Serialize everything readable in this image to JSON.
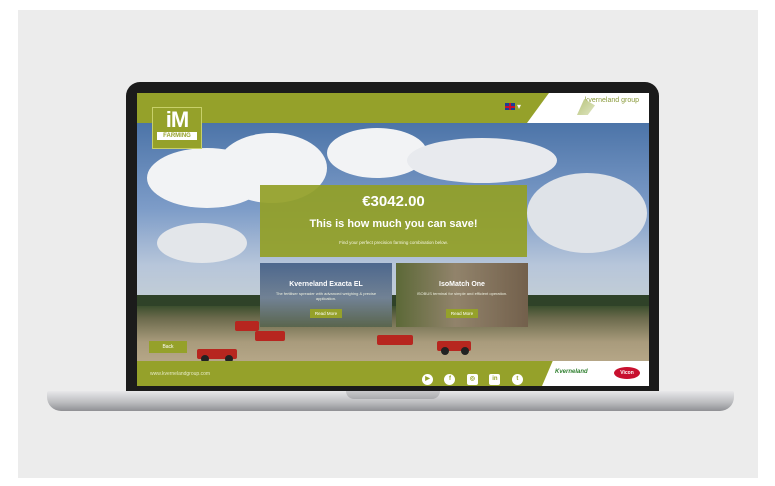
{
  "header": {
    "logo_main": "iM",
    "logo_sub": "FARMING",
    "language_indicator": "▾",
    "group_logo_text": "kverneland group"
  },
  "hero": {
    "price": "€3042.00",
    "title": "This is how much you can save!",
    "subtitle": "Find your perfect precision farming combination below."
  },
  "cards": [
    {
      "title": "Kverneland Exacta EL",
      "text": "The fertiliser spreader with advanced weighing & precise application.",
      "button": "Read More"
    },
    {
      "title": "IsoMatch One",
      "text": "ISOBUS terminal for simple and efficient operation.",
      "button": "Read More"
    }
  ],
  "back_button": "Back",
  "footer": {
    "url": "www.kvernelandgroup.com",
    "socials": [
      "youtube-icon",
      "facebook-icon",
      "instagram-icon",
      "linkedin-icon",
      "twitter-icon"
    ],
    "brand1": "Kverneland",
    "brand2": "Vicon"
  },
  "colors": {
    "accent": "#95a12a",
    "background": "#ececec"
  }
}
